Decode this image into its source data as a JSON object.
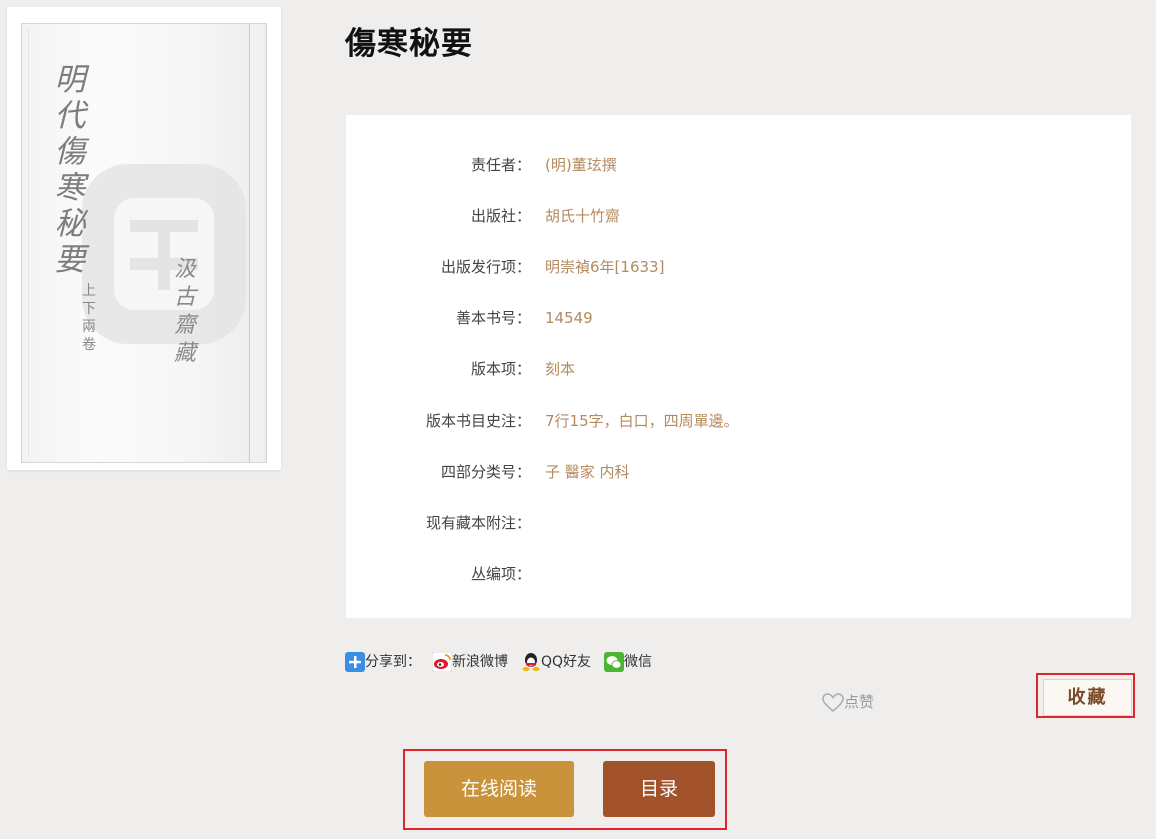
{
  "cover": {
    "title_chars": [
      "明",
      "代",
      "傷",
      "寒",
      "秘",
      "要"
    ],
    "subtitle_chars": [
      "上",
      "下",
      "兩",
      "卷"
    ],
    "stamp_chars": [
      "汲",
      "古",
      "齋",
      "藏"
    ]
  },
  "book": {
    "title": "傷寒秘要"
  },
  "details": [
    {
      "label": "责任者：",
      "value": "(明)董玹撰"
    },
    {
      "label": "出版社：",
      "value": "胡氏十竹齋"
    },
    {
      "label": "出版发行项：",
      "value": "明崇禎6年[1633]"
    },
    {
      "label": "善本书号：",
      "value": "14549"
    },
    {
      "label": "版本项：",
      "value": "刻本"
    },
    {
      "label": "版本书目史注：",
      "value": "7行15字，白口，四周單邊。"
    },
    {
      "label": "四部分类号：",
      "value": "子 醫家 内科"
    },
    {
      "label": "现有藏本附注：",
      "value": ""
    },
    {
      "label": "丛编项：",
      "value": ""
    }
  ],
  "share": {
    "label": "分享到：",
    "weibo": "新浪微博",
    "qq": "QQ好友",
    "wechat": "微信",
    "icons": [
      "plus-share-icon",
      "weibo-icon",
      "qq-icon",
      "wechat-icon"
    ]
  },
  "like": {
    "label": "点赞",
    "icon": "heart-icon"
  },
  "favorite": {
    "label": "收藏"
  },
  "actions": {
    "read_online": "在线阅读",
    "toc": "目录"
  },
  "colors": {
    "value": "#b48a5f",
    "read_btn": "#c8933a",
    "toc_btn": "#a1522a",
    "highlight": "#e0262d"
  }
}
